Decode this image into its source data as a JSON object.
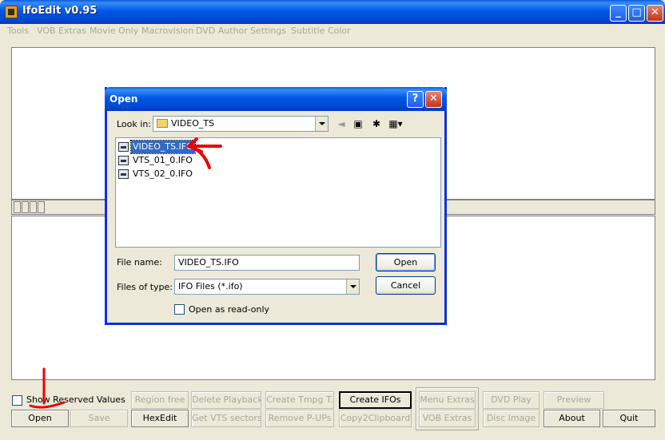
{
  "window": {
    "title": "IfoEdit v0.95",
    "controls": {
      "minimize": "_",
      "maximize": "□",
      "close": "✕"
    }
  },
  "menu": [
    "Tools",
    "VOB Extras",
    "Movie Only",
    "Macrovision",
    "DVD Author",
    "Settings",
    "Subtitle Color"
  ],
  "bottom": {
    "checkbox_label": "Show Reserved Values",
    "buttons": {
      "open": "Open",
      "save": "Save",
      "region_free": "Region free",
      "hexedit": "HexEdit",
      "delete_playback": "Delete Playback",
      "get_vts_sectors": "Get VTS sectors",
      "create_tmpg": "Create Tmpg T.",
      "remove_pups": "Remove P-UPs",
      "create_ifos": "Create IFOs",
      "copy2clipboard": "Copy2Clipboard",
      "menu_extras": "Menu Extras",
      "vob_extras": "VOB Extras",
      "dvd_play": "DVD Play",
      "disc_image": "Disc Image",
      "preview": "Preview",
      "about": "About",
      "quit": "Quit"
    }
  },
  "dialog": {
    "title": "Open",
    "help": "?",
    "close": "✕",
    "look_in_label": "Look in:",
    "look_in_value": "VIDEO_TS",
    "files": [
      "VIDEO_TS.IFO",
      "VTS_01_0.IFO",
      "VTS_02_0.IFO"
    ],
    "selected_index": 0,
    "file_name_label": "File name:",
    "file_name_value": "VIDEO_TS.IFO",
    "files_of_type_label": "Files of type:",
    "files_of_type_value": "IFO Files (*.ifo)",
    "readonly_label": "Open as read-only",
    "open_button": "Open",
    "cancel_button": "Cancel"
  },
  "colors": {
    "titlebar": "#0054e3",
    "selection": "#316ac5",
    "annotation": "#ee0000",
    "disabled_text": "#aca899"
  }
}
